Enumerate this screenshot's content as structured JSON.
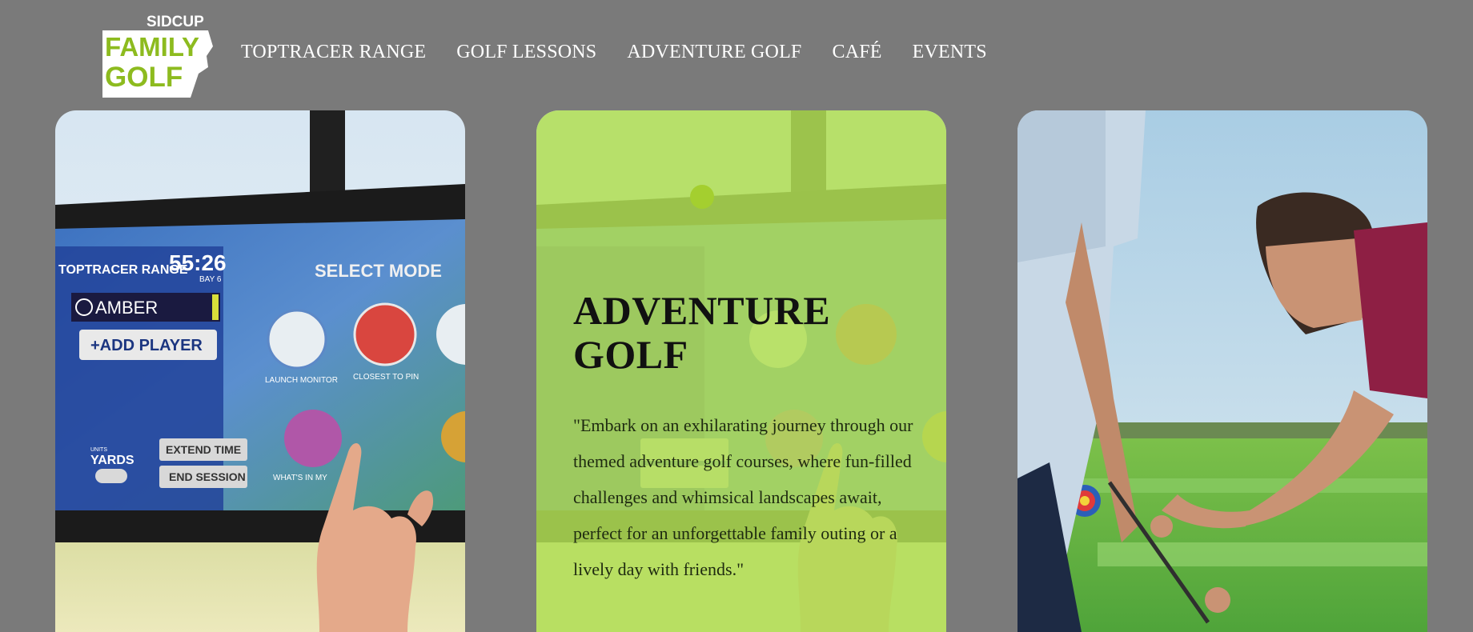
{
  "brand": {
    "logo_lines": [
      "SIDCUP",
      "FAMILY",
      "GOLF"
    ],
    "accent_color": "#8dbb1f"
  },
  "nav": {
    "items": [
      {
        "label": "TOPTRACER RANGE"
      },
      {
        "label": "GOLF LESSONS"
      },
      {
        "label": "ADVENTURE GOLF"
      },
      {
        "label": "CAFÉ"
      },
      {
        "label": "EVENTS"
      }
    ]
  },
  "cards": {
    "toptracer": {
      "screen": {
        "brand": "TOPTRACER RANGE",
        "timer": "55:26",
        "bay": "BAY 6",
        "title": "SELECT MODE",
        "player": "AMBER",
        "add_player": "+ADD PLAYER",
        "units_label": "UNITS",
        "units": "YARDS",
        "extend": "EXTEND TIME",
        "end": "END SESSION",
        "modes": [
          "LAUNCH MONITOR",
          "CLOSEST TO PIN",
          "WHAT'S IN MY"
        ]
      }
    },
    "adventure": {
      "title": "ADVENTURE GOLF",
      "description": "\"Embark on an exhilarating journey through our themed adventure golf courses, where fun-filled challenges and whimsical landscapes await, perfect for an unforgettable family outing or a lively day with friends.\"",
      "overlay_color": "#b1de54"
    },
    "lessons": {
      "image_subject": "golf-lesson-photo"
    }
  }
}
